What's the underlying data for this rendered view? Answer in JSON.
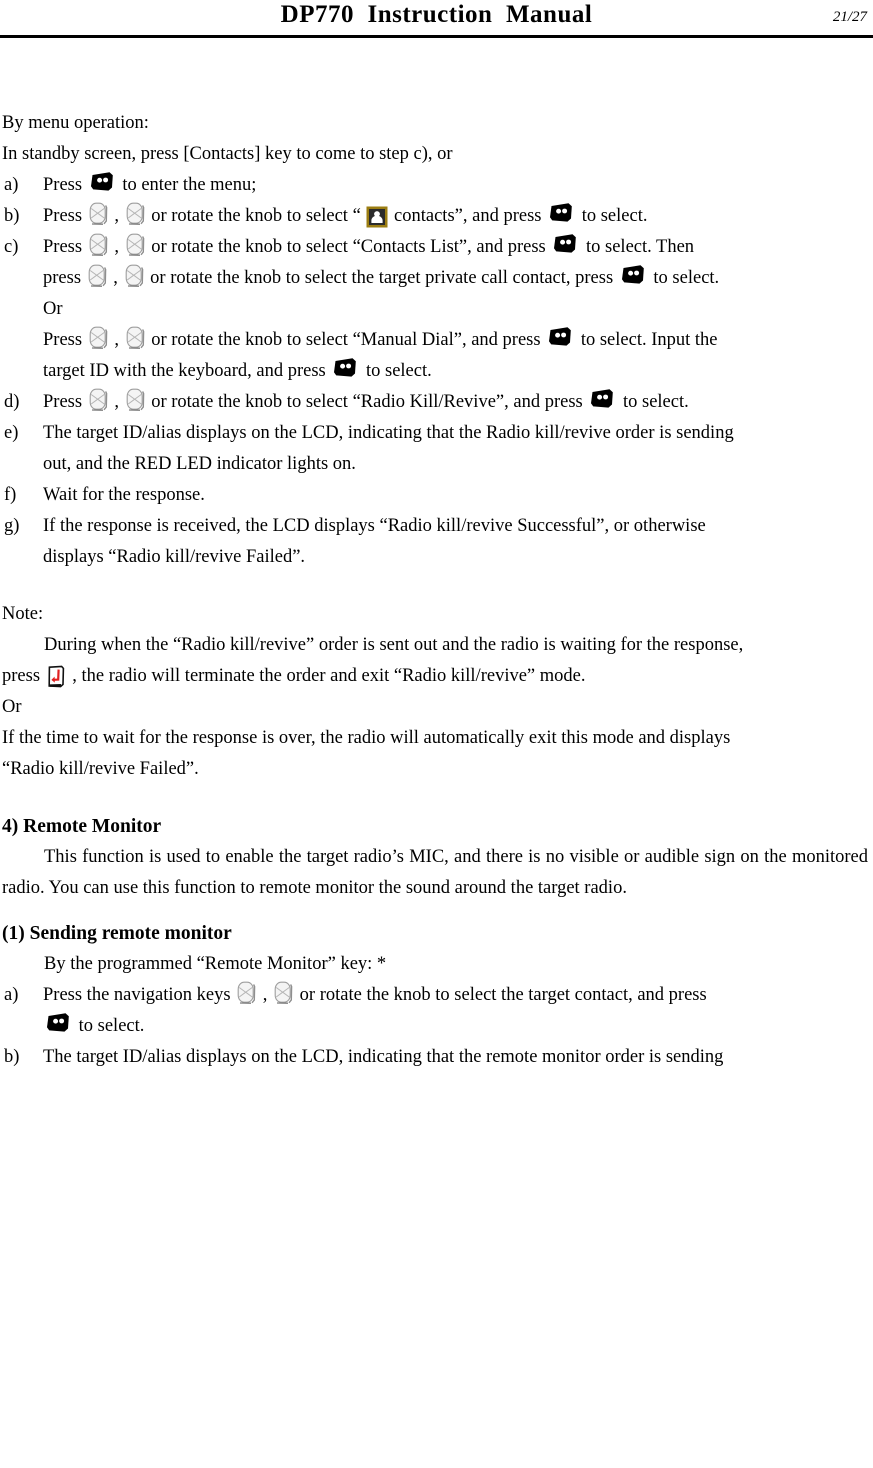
{
  "header": {
    "title": "DP770  Instruction  Manual",
    "page_number": "21/27"
  },
  "icons": {
    "nav_key": "nav-key-icon",
    "menu_key": "menu-key-icon",
    "back_key": "back-key-icon",
    "contacts": "contacts-icon"
  },
  "colors": {
    "text": "#000000",
    "background": "#ffffff",
    "rule": "#000000",
    "contacts_frame": "#9b7d12",
    "contacts_inner": "#c9a227",
    "contacts_person": "#ffffff",
    "back_arrow_red": "#e02020",
    "nav_key_fill": "#f2f2f2",
    "nav_key_stroke": "#9a9a9a",
    "menu_key_fill": "#000000",
    "menu_key_dot": "#ffffff"
  },
  "body": {
    "intro_menu_operation": "By menu operation:",
    "intro_standby": "In standby screen, press [Contacts] key to come to step c), or",
    "step_a": {
      "marker": "a)",
      "text_1": "Press",
      "text_2": "to enter the menu;"
    },
    "step_b": {
      "marker": "b)",
      "text_1": "Press",
      "text_2": ",",
      "text_3": "or rotate the knob to select “",
      "text_4": "contacts”, and press",
      "text_5": "to select."
    },
    "step_c": {
      "marker": "c)",
      "text_1": "Press",
      "text_2": ",",
      "text_3": "or rotate the knob to select “Contacts List”, and press",
      "text_4": "to select. Then",
      "text_5": "press",
      "text_6": ",",
      "text_7": "or rotate the knob to select the target private call contact, press",
      "text_8": "to select.",
      "or_label": "Or",
      "text_9": "Press",
      "text_10": ",",
      "text_11": "or rotate the knob to select “Manual Dial”, and press",
      "text_12": "to select. Input the",
      "text_13": "target ID with the keyboard, and press",
      "text_14": "to select."
    },
    "step_d": {
      "marker": "d)",
      "text_1": "Press",
      "text_2": ",",
      "text_3": "or rotate the knob to select “Radio Kill/Revive”, and press",
      "text_4": "to select."
    },
    "step_e": {
      "marker": "e)",
      "text_1": "The target ID/alias displays on the LCD, indicating that the Radio kill/revive order is sending",
      "text_2": "out, and the RED LED indicator lights on."
    },
    "step_f": {
      "marker": "f)",
      "text_1": "Wait for the response."
    },
    "step_g": {
      "marker": "g)",
      "text_1": "If the response is received, the LCD displays “Radio kill/revive Successful”, or otherwise",
      "text_2": "displays “Radio kill/revive Failed”."
    },
    "note": {
      "label": "Note:",
      "text_1": "During when the “Radio kill/revive” order is sent out and the radio is waiting for the response,",
      "text_2": "press",
      "text_3": ", the radio will terminate the order and exit “Radio kill/revive” mode.",
      "or_label": "Or",
      "text_4": "If the time to wait for the response is over, the radio will automatically exit this mode and displays",
      "text_5": "“Radio kill/revive Failed”."
    },
    "remote_monitor": {
      "heading": "4) Remote Monitor",
      "paragraph_1": "This function is used to enable the target radio’s MIC, and there is no visible or audible sign on the monitored radio. You can use this function to remote monitor the sound around the target radio.",
      "sub_heading": "(1) Sending remote monitor",
      "programmed_key_line": "By the programmed “Remote Monitor” key: *",
      "step_a": {
        "marker": "a)",
        "text_1": "Press the navigation keys",
        "text_2": ",",
        "text_3": "or rotate the knob to select the target contact, and press",
        "text_4": "to select."
      },
      "step_b": {
        "marker": "b)",
        "text_1": "The target ID/alias displays on the LCD, indicating that the remote monitor order is sending"
      }
    }
  }
}
